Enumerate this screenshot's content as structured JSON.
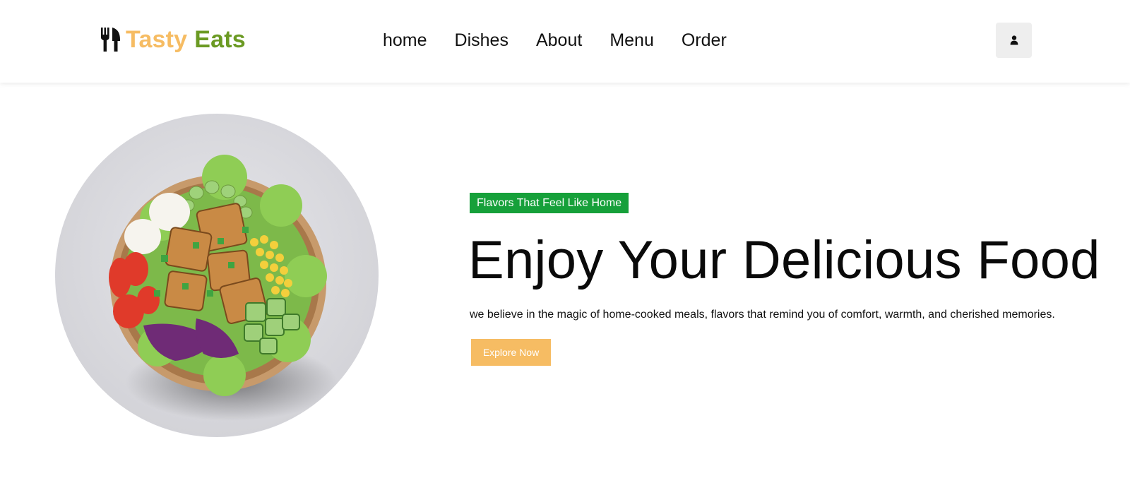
{
  "header": {
    "logo": {
      "icon": "utensils-icon",
      "word_1": "Tasty",
      "word_2": "Eats",
      "colors": {
        "word_1": "#f6bc63",
        "word_2": "#6b9a23"
      }
    },
    "nav": [
      {
        "label": "home"
      },
      {
        "label": "Dishes"
      },
      {
        "label": "About"
      },
      {
        "label": "Menu"
      },
      {
        "label": "Order"
      }
    ],
    "user_button": {
      "icon": "user-icon"
    }
  },
  "hero": {
    "image": {
      "subject": "salad-bowl-image"
    },
    "tagline": "Flavors That Feel Like Home",
    "headline": "Enjoy Your Delicious Food",
    "description": "we believe in the magic of home-cooked meals, flavors that remind you of comfort, warmth, and cherished memories.",
    "cta_label": "Explore Now",
    "colors": {
      "tagline_bg": "#16a03a",
      "cta_bg": "#f6bc63"
    }
  }
}
